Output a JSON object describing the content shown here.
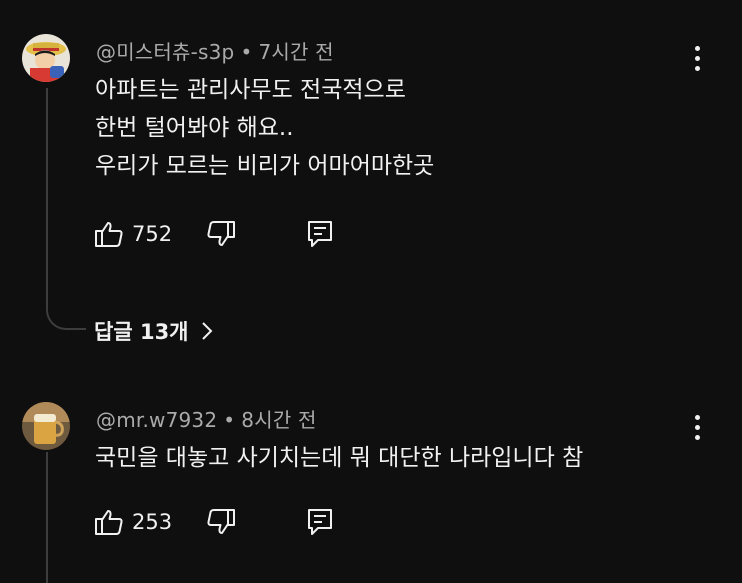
{
  "comments": [
    {
      "author": "@미스터츄-s3p",
      "separator": "•",
      "time": "7시간 전",
      "lines": [
        "아파트는 관리사무도 전국적으로",
        "한번 털어봐야 해요..",
        "우리가 모르는 비리가 어마어마한곳"
      ],
      "likes": "752",
      "avatar_icon": "luffy-avatar-icon",
      "replies_label": "답글 13개"
    },
    {
      "author": "@mr.w7932",
      "separator": "•",
      "time": "8시간 전",
      "lines": [
        "국민을 대놓고 사기치는데 뭐 대단한 나라입니다 참"
      ],
      "likes": "253",
      "avatar_icon": "beer-glass-avatar-icon"
    }
  ],
  "colors": {
    "background": "#0f0f0f",
    "text": "#f1f1f1",
    "meta": "#aaaaaa",
    "thread": "#3d3d3d"
  }
}
